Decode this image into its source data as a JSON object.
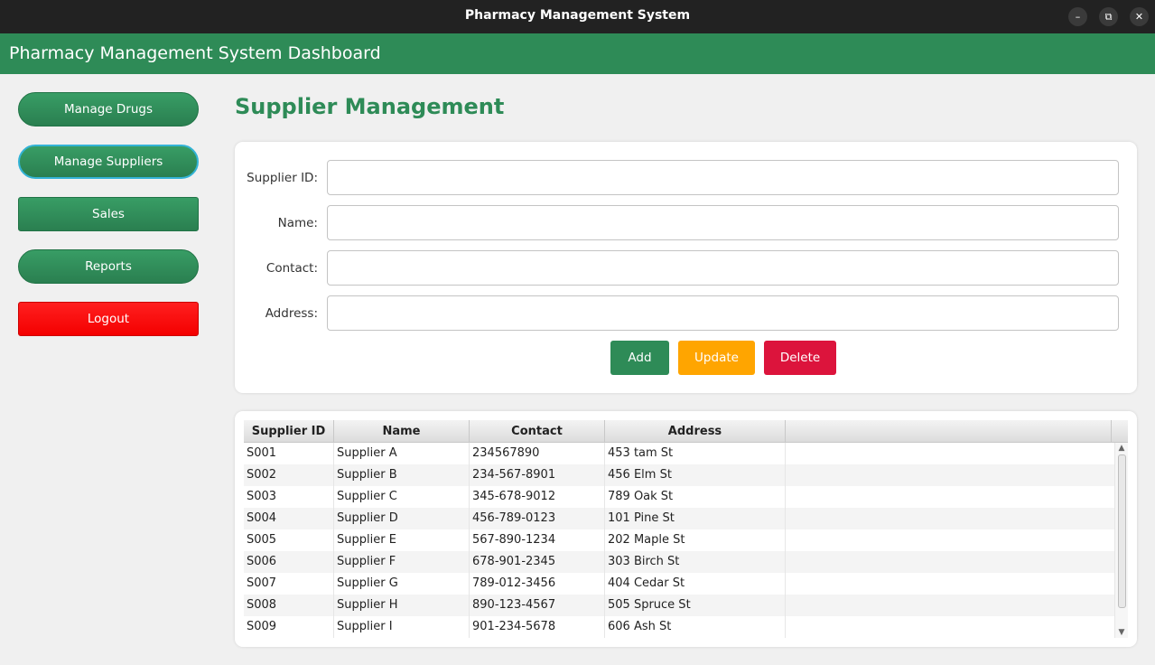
{
  "window": {
    "title": "Pharmacy Management System",
    "minimize_glyph": "–",
    "maximize_glyph": "⧉",
    "close_glyph": "✕"
  },
  "header": {
    "title": "Pharmacy Management System Dashboard",
    "color": "#2e8b57"
  },
  "sidebar": {
    "items": [
      {
        "label": "Manage Drugs"
      },
      {
        "label": "Manage Suppliers",
        "active": true
      },
      {
        "label": "Sales"
      },
      {
        "label": "Reports"
      },
      {
        "label": "Logout",
        "color": "#ff0000"
      }
    ]
  },
  "main": {
    "title": "Supplier Management"
  },
  "form": {
    "fields": [
      {
        "label": "Supplier ID:",
        "value": ""
      },
      {
        "label": "Name:",
        "value": ""
      },
      {
        "label": "Contact:",
        "value": ""
      },
      {
        "label": "Address:",
        "value": ""
      }
    ],
    "buttons": {
      "add": {
        "label": "Add",
        "color": "#2e8b57"
      },
      "update": {
        "label": "Update",
        "color": "#ffa500"
      },
      "delete": {
        "label": "Delete",
        "color": "#dc143c"
      }
    }
  },
  "table": {
    "columns": [
      "Supplier ID",
      "Name",
      "Contact",
      "Address"
    ],
    "rows": [
      [
        "S001",
        "Supplier A",
        "234567890",
        "453 tam St"
      ],
      [
        "S002",
        "Supplier B",
        "234-567-8901",
        "456 Elm St"
      ],
      [
        "S003",
        "Supplier C",
        "345-678-9012",
        "789 Oak St"
      ],
      [
        "S004",
        "Supplier D",
        "456-789-0123",
        "101 Pine St"
      ],
      [
        "S005",
        "Supplier E",
        "567-890-1234",
        "202 Maple St"
      ],
      [
        "S006",
        "Supplier F",
        "678-901-2345",
        "303 Birch St"
      ],
      [
        "S007",
        "Supplier G",
        "789-012-3456",
        "404 Cedar St"
      ],
      [
        "S008",
        "Supplier H",
        "890-123-4567",
        "505 Spruce St"
      ],
      [
        "S009",
        "Supplier I",
        "901-234-5678",
        "606 Ash St"
      ]
    ]
  }
}
